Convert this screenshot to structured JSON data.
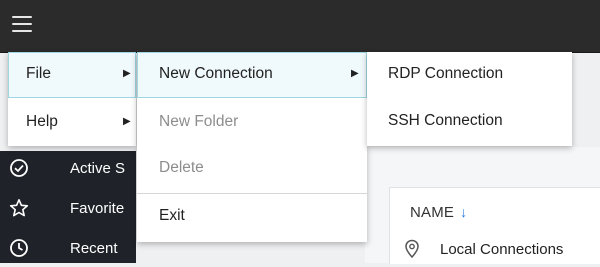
{
  "topbar": {
    "menu_icon": "hamburger-icon"
  },
  "main_menu": {
    "items": [
      {
        "label": "File",
        "has_submenu": true,
        "active": true
      },
      {
        "label": "Help",
        "has_submenu": true,
        "active": false
      }
    ]
  },
  "file_submenu": {
    "items": [
      {
        "label": "New Connection",
        "has_submenu": true,
        "enabled": true,
        "active": true
      },
      {
        "label": "New Folder",
        "enabled": false
      },
      {
        "label": "Delete",
        "enabled": false
      },
      {
        "label": "Exit",
        "enabled": true
      }
    ]
  },
  "new_connection_submenu": {
    "items": [
      {
        "label": "RDP Connection"
      },
      {
        "label": "SSH Connection"
      }
    ]
  },
  "sidebar": {
    "items": [
      {
        "label": "Active S",
        "icon": "check-circle-icon"
      },
      {
        "label": "Favorite",
        "icon": "star-icon"
      },
      {
        "label": "Recent",
        "icon": "clock-icon"
      }
    ]
  },
  "content": {
    "column_header": "NAME",
    "sort_icon": "arrow-down-icon",
    "rows": [
      {
        "label": "Local Connections",
        "icon": "location-pin-icon"
      }
    ]
  }
}
